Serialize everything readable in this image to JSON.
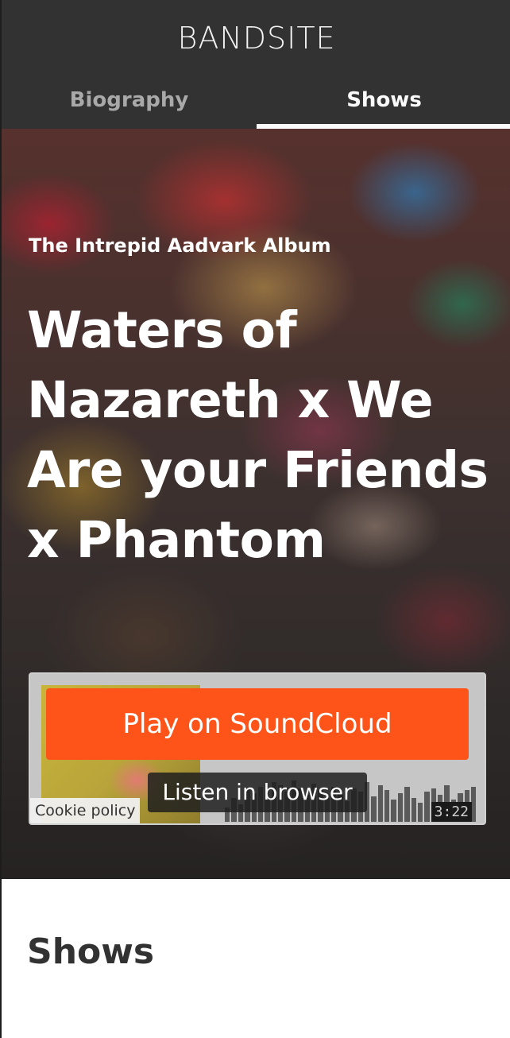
{
  "header": {
    "logo": "BANDSITE",
    "tabs": [
      {
        "label": "Biography",
        "active": false
      },
      {
        "label": "Shows",
        "active": true
      }
    ]
  },
  "hero": {
    "album": "The Intrepid Aadvark Album",
    "title_lines": [
      "Waters of",
      "Nazareth x We",
      "Are your Friends",
      "x Phantom"
    ]
  },
  "player": {
    "play_label": "Play on SoundCloud",
    "listen_label": "Listen in browser",
    "duration": "3:22",
    "cookie_label": "Cookie policy",
    "accent_color": "#ff5419"
  },
  "main": {
    "shows_heading": "Shows"
  }
}
